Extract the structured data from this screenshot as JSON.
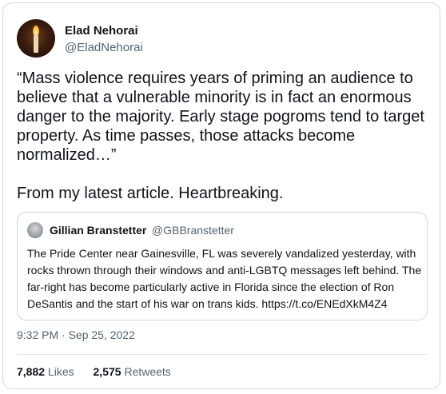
{
  "author": {
    "name": "Elad Nehorai",
    "handle": "@EladNehorai",
    "avatar_icon": "candle-avatar"
  },
  "tweet": {
    "paragraphs": [
      "“Mass violence requires years of priming an audience to believe that a vulnerable minority is in fact an enormous danger to the majority. Early stage pogroms tend to target property. As time passes, those attacks become normalized…”",
      "From my latest article. Heartbreaking."
    ]
  },
  "quoted_tweet": {
    "name": "Gillian Branstetter",
    "handle": "@GBBranstetter",
    "text": "The Pride Center near Gainesville, FL was severely vandalized yesterday, with rocks thrown through their windows and anti-LGBTQ messages left behind. The far-right has become particularly active in Florida since the election of Ron DeSantis and the start of his war on trans kids. https://t.co/ENEdXkM4Z4"
  },
  "timestamp": "9:32 PM · Sep 25, 2022",
  "stats": {
    "likes_count": "7,882",
    "likes_label": "Likes",
    "retweets_count": "2,575",
    "retweets_label": "Retweets"
  },
  "colors": {
    "border": "#cfd9de",
    "secondary_text": "#536471",
    "primary_text": "#0f1419"
  }
}
